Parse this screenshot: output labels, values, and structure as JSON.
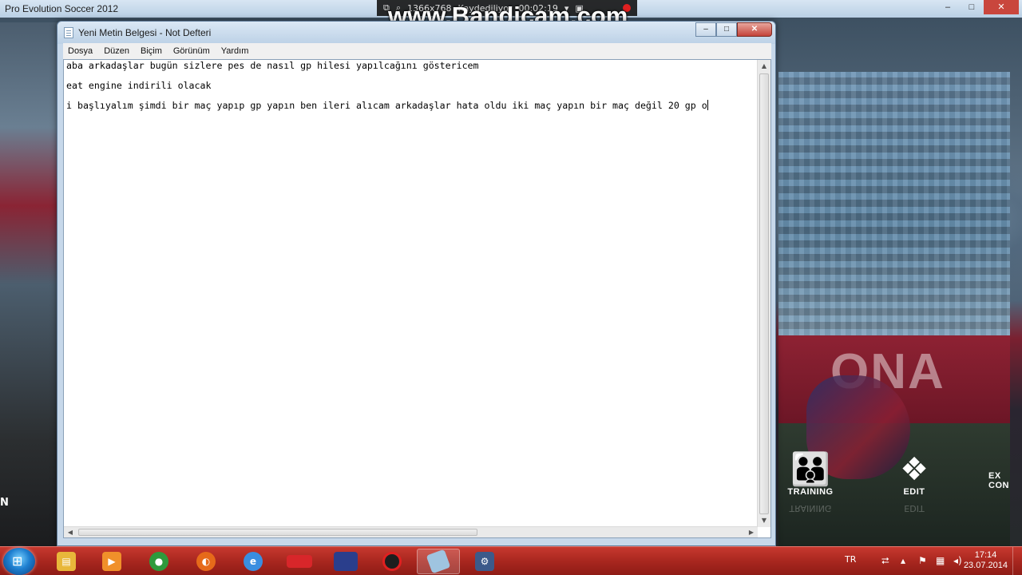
{
  "game": {
    "title": "Pro Evolution Soccer 2012",
    "menu": [
      {
        "label": "TRAINING",
        "icon": "training-icon"
      },
      {
        "label": "EDIT",
        "icon": "puzzle-icon"
      }
    ],
    "partial_left_label": "N",
    "partial_right_label": "EX CON",
    "banner_text": "ONA"
  },
  "bandicam": {
    "resolution": "1366x768",
    "status": "Kaydediliyor",
    "time": "00:02:19",
    "logo": "www.Bandicam.com"
  },
  "notepad": {
    "title": "Yeni Metin Belgesi - Not Defteri",
    "menu": [
      "Dosya",
      "Düzen",
      "Biçim",
      "Görünüm",
      "Yardım"
    ],
    "lines": [
      "aba arkadaşlar bugün sizlere pes de nasıl gp hilesi yapılcağını göstericem",
      "eat engine indirili olacak",
      "i başlıyalım şimdi bir maç yapıp gp yapın ben ileri alıcam arkadaşlar hata oldu iki maç yapın bir maç değil 20 gp o"
    ]
  },
  "taskbar": {
    "items": [
      {
        "name": "explorer",
        "icon": "folder-icon",
        "color": "#e8b73a"
      },
      {
        "name": "media-player",
        "icon": "media-player-icon",
        "color": "#f0902a"
      },
      {
        "name": "chrome",
        "icon": "chrome-icon",
        "color": "#2e9a3c"
      },
      {
        "name": "firefox",
        "icon": "firefox-icon",
        "color": "#e66a1a"
      },
      {
        "name": "internet-explorer",
        "icon": "ie-icon",
        "color": "#3a8ee0"
      },
      {
        "name": "gsm",
        "icon": "gsm-app-icon",
        "color": "#d8262a"
      },
      {
        "name": "pes-launcher",
        "icon": "pes-icon",
        "color": "#2a3e8c"
      },
      {
        "name": "bandicam",
        "icon": "record-icon",
        "color": "#1e1e1e"
      },
      {
        "name": "notepad",
        "icon": "notepad-icon",
        "color": "#9fc4e0",
        "active": true
      },
      {
        "name": "settings",
        "icon": "gear-icon",
        "color": "#3c5a8a"
      }
    ],
    "tray": {
      "language": "TR",
      "time": "17:14",
      "date": "23.07.2014"
    }
  }
}
